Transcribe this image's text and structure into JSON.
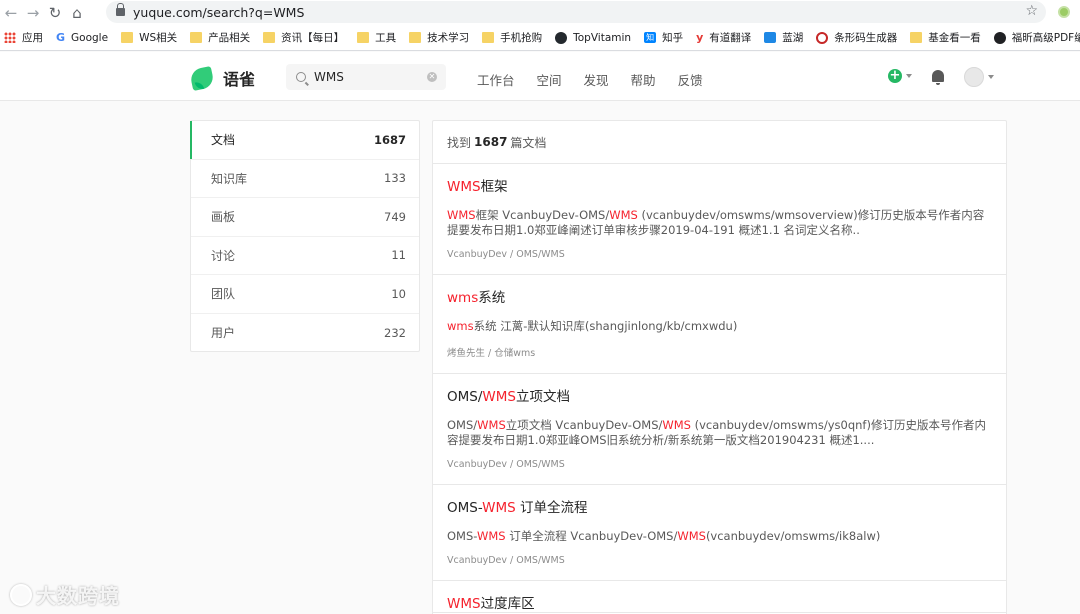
{
  "browser": {
    "url": "yuque.com/search?q=WMS",
    "bookmarks": [
      {
        "label": "应用",
        "icon": "apps-grid-icon"
      },
      {
        "label": "Google",
        "icon": "google-icon"
      },
      {
        "label": "WS相关",
        "icon": "folder-icon"
      },
      {
        "label": "产品相关",
        "icon": "folder-icon"
      },
      {
        "label": "资讯【每日】",
        "icon": "folder-icon"
      },
      {
        "label": "工具",
        "icon": "folder-icon"
      },
      {
        "label": "技术学习",
        "icon": "folder-icon"
      },
      {
        "label": "手机抢购",
        "icon": "folder-icon"
      },
      {
        "label": "TopVitamin",
        "icon": "github-icon"
      },
      {
        "label": "知乎",
        "icon": "zhihu-icon"
      },
      {
        "label": "有道翻译",
        "icon": "youdao-icon"
      },
      {
        "label": "蓝湖",
        "icon": "lanhu-icon"
      },
      {
        "label": "条形码生成器",
        "icon": "barcode-icon"
      },
      {
        "label": "基金看一看",
        "icon": "folder-icon"
      },
      {
        "label": "福昕高级PDF编辑...",
        "icon": "globe-icon"
      }
    ]
  },
  "header": {
    "logo_text": "语雀",
    "search_value": "WMS",
    "nav": [
      "工作台",
      "空间",
      "发现",
      "帮助",
      "反馈"
    ]
  },
  "filters": [
    {
      "label": "文档",
      "count": "1687",
      "active": true
    },
    {
      "label": "知识库",
      "count": "133"
    },
    {
      "label": "画板",
      "count": "749"
    },
    {
      "label": "讨论",
      "count": "11"
    },
    {
      "label": "团队",
      "count": "10"
    },
    {
      "label": "用户",
      "count": "232"
    }
  ],
  "results": {
    "summary_prefix": "找到",
    "summary_count": "1687",
    "summary_suffix": "篇文档",
    "items": [
      {
        "title": [
          {
            "t": "WMS",
            "hl": true
          },
          {
            "t": "框架"
          }
        ],
        "snippet": [
          {
            "t": "WMS",
            "hl": true
          },
          {
            "t": "框架 VcanbuyDev-OMS/"
          },
          {
            "t": "WMS",
            "hl": true
          },
          {
            "t": " (vcanbuydev/omswms/wmsoverview)修订历史版本号作者内容提要发布日期1.0郑亚峰阐述订单审核步骤2019-04-191 概述1.1 名词定义名称.."
          }
        ],
        "path": "VcanbuyDev / OMS/WMS"
      },
      {
        "title": [
          {
            "t": "wms",
            "hl": true
          },
          {
            "t": "系统"
          }
        ],
        "snippet": [
          {
            "t": "wms",
            "hl": true
          },
          {
            "t": "系统 江蓠-默认知识库(shangjinlong/kb/cmxwdu)"
          }
        ],
        "path": "烤鱼先生 / 仓储wms"
      },
      {
        "title": [
          {
            "t": "OMS/"
          },
          {
            "t": "WMS",
            "hl": true
          },
          {
            "t": "立项文档"
          }
        ],
        "snippet": [
          {
            "t": "OMS/"
          },
          {
            "t": "WMS",
            "hl": true
          },
          {
            "t": "立项文档 VcanbuyDev-OMS/"
          },
          {
            "t": "WMS",
            "hl": true
          },
          {
            "t": " (vcanbuydev/omswms/ys0qnf)修订历史版本号作者内容提要发布日期1.0郑亚峰OMS旧系统分析/新系统第一版文档201904231 概述1...."
          }
        ],
        "path": "VcanbuyDev / OMS/WMS"
      },
      {
        "title": [
          {
            "t": "OMS-"
          },
          {
            "t": "WMS",
            "hl": true
          },
          {
            "t": " 订单全流程"
          }
        ],
        "snippet": [
          {
            "t": "OMS-"
          },
          {
            "t": "WMS",
            "hl": true
          },
          {
            "t": " 订单全流程 VcanbuyDev-OMS/"
          },
          {
            "t": "WMS",
            "hl": true
          },
          {
            "t": "(vcanbuydev/omswms/ik8alw)"
          }
        ],
        "path": "VcanbuyDev / OMS/WMS"
      },
      {
        "title": [
          {
            "t": "WMS",
            "hl": true
          },
          {
            "t": "过度库区"
          }
        ],
        "snippet": [],
        "path": ""
      }
    ]
  },
  "watermark": "大数跨境",
  "colors": {
    "accent": "#25b864",
    "highlight": "#f5222d"
  }
}
